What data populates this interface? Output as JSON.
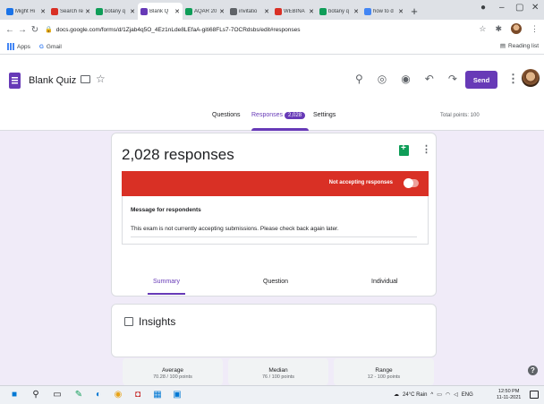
{
  "browser": {
    "tabs": [
      {
        "label": "Might Hi",
        "color": "#1a73e8"
      },
      {
        "label": "Search re",
        "color": "#d93025"
      },
      {
        "label": "botany q",
        "color": "#0f9d58"
      },
      {
        "label": "Blank Q",
        "color": "#673ab7",
        "active": true
      },
      {
        "label": "AQAR 20",
        "color": "#0f9d58"
      },
      {
        "label": "invitatio",
        "color": "#5f6368"
      },
      {
        "label": "WEBINA",
        "color": "#d93025"
      },
      {
        "label": "botany q",
        "color": "#0f9d58"
      },
      {
        "label": "how to d",
        "color": "#4285f4"
      }
    ],
    "url": "docs.google.com/forms/d/1Zjab4q5O_4Ez1nLde8LEfaA-giti68FLs7-7OCRdsbs/edit#responses",
    "bookmarks": {
      "apps": "Apps",
      "gmail": "Gmail",
      "reading_list": "Reading list"
    }
  },
  "form": {
    "title": "Blank Quiz",
    "send_label": "Send",
    "tabs": {
      "questions": "Questions",
      "responses": "Responses",
      "responses_count": "2,028",
      "settings": "Settings"
    },
    "total_points": "Total points: 100"
  },
  "responses": {
    "title": "2,028 responses",
    "not_accepting": "Not accepting responses",
    "message_label": "Message for respondents",
    "message_text": "This exam is not currently accepting submissions. Please check back again later.",
    "subtabs": {
      "summary": "Summary",
      "question": "Question",
      "individual": "Individual"
    }
  },
  "insights": {
    "title": "Insights",
    "stats": [
      {
        "label": "Average",
        "value": "70.28 / 100 points"
      },
      {
        "label": "Median",
        "value": "76 / 100 points"
      },
      {
        "label": "Range",
        "value": "12 - 100 points"
      }
    ]
  },
  "taskbar": {
    "weather": "24°C Rain",
    "lang": "ENG",
    "time": "12:50 PM",
    "date": "11-11-2021"
  },
  "colors": {
    "accent": "#673ab7",
    "banner": "#d93025",
    "background": "#f0ebf8"
  }
}
